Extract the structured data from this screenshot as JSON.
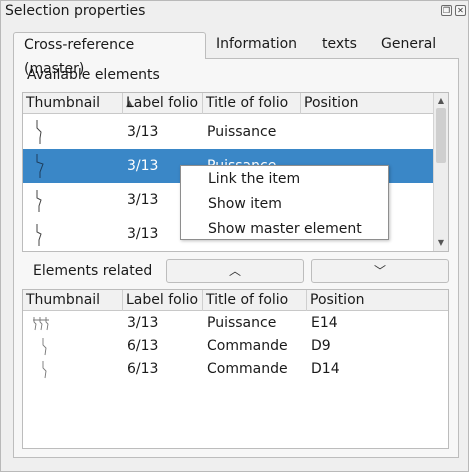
{
  "window": {
    "title": "Selection properties",
    "float_icon": "float-icon",
    "close_icon": "close-icon"
  },
  "tabs": [
    {
      "label": "Cross-reference (master)"
    },
    {
      "label": "Information"
    },
    {
      "label": "texts"
    },
    {
      "label": "General"
    }
  ],
  "available": {
    "label": "Available elements",
    "columns": [
      "Thumbnail",
      "Label folio",
      "Title of folio",
      "Position"
    ],
    "rows": [
      {
        "label_folio": "3/13",
        "title": "Puissance",
        "position": ""
      },
      {
        "label_folio": "3/13",
        "title": "Puissance",
        "position": "",
        "selected": true
      },
      {
        "label_folio": "3/13",
        "title": "",
        "position": ""
      },
      {
        "label_folio": "3/13",
        "title": "",
        "position": ""
      }
    ]
  },
  "context_menu": {
    "items": [
      "Link the item",
      "Show item",
      "Show master element"
    ]
  },
  "related": {
    "label": "Elements related",
    "up_icon": "chevron-up-icon",
    "down_icon": "chevron-down-icon",
    "columns": [
      "Thumbnail",
      "Label folio",
      "Title of folio",
      "Position"
    ],
    "rows": [
      {
        "label_folio": "3/13",
        "title": "Puissance",
        "position": "E14"
      },
      {
        "label_folio": "6/13",
        "title": "Commande",
        "position": "D9"
      },
      {
        "label_folio": "6/13",
        "title": "Commande",
        "position": "D14"
      }
    ]
  }
}
